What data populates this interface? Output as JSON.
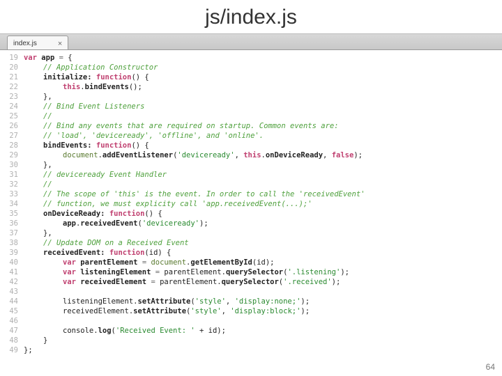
{
  "title": "js/index.js",
  "tab": {
    "label": "index.js",
    "close": "×"
  },
  "line_start": 19,
  "line_end": 49,
  "page_number": "64",
  "code_lines": [
    [
      [
        "kw",
        "var"
      ],
      [
        "pl",
        " "
      ],
      [
        "nm",
        "app"
      ],
      [
        "pl",
        " "
      ],
      [
        "op",
        "="
      ],
      [
        "pl",
        " {"
      ]
    ],
    [
      [
        "ind1",
        ""
      ],
      [
        "cm",
        "// Application Constructor"
      ]
    ],
    [
      [
        "ind1",
        ""
      ],
      [
        "nm",
        "initialize:"
      ],
      [
        "pl",
        " "
      ],
      [
        "kw",
        "function"
      ],
      [
        "pl",
        "() {"
      ]
    ],
    [
      [
        "ind2",
        ""
      ],
      [
        "kw",
        "this"
      ],
      [
        "pl",
        "."
      ],
      [
        "nm",
        "bindEvents"
      ],
      [
        "pl",
        "();"
      ]
    ],
    [
      [
        "ind1",
        ""
      ],
      [
        "pl",
        "},"
      ]
    ],
    [
      [
        "ind1",
        ""
      ],
      [
        "cm",
        "// Bind Event Listeners"
      ]
    ],
    [
      [
        "ind1",
        ""
      ],
      [
        "cm",
        "//"
      ]
    ],
    [
      [
        "ind1",
        ""
      ],
      [
        "cm",
        "// Bind any events that are required on startup. Common events are:"
      ]
    ],
    [
      [
        "ind1",
        ""
      ],
      [
        "cm",
        "// 'load', 'deviceready', 'offline', and 'online'."
      ]
    ],
    [
      [
        "ind1",
        ""
      ],
      [
        "nm",
        "bindEvents:"
      ],
      [
        "pl",
        " "
      ],
      [
        "kw",
        "function"
      ],
      [
        "pl",
        "() {"
      ]
    ],
    [
      [
        "ind2",
        ""
      ],
      [
        "doc",
        "document"
      ],
      [
        "pl",
        "."
      ],
      [
        "nm",
        "addEventListener"
      ],
      [
        "pl",
        "("
      ],
      [
        "str",
        "'deviceready'"
      ],
      [
        "pl",
        ", "
      ],
      [
        "kw",
        "this"
      ],
      [
        "pl",
        "."
      ],
      [
        "nm",
        "onDeviceReady"
      ],
      [
        "pl",
        ", "
      ],
      [
        "kw",
        "false"
      ],
      [
        "pl",
        ");"
      ]
    ],
    [
      [
        "ind1",
        ""
      ],
      [
        "pl",
        "},"
      ]
    ],
    [
      [
        "ind1",
        ""
      ],
      [
        "cm",
        "// deviceready Event Handler"
      ]
    ],
    [
      [
        "ind1",
        ""
      ],
      [
        "cm",
        "//"
      ]
    ],
    [
      [
        "ind1",
        ""
      ],
      [
        "cm",
        "// The scope of 'this' is the event. In order to call the 'receivedEvent'"
      ]
    ],
    [
      [
        "ind1",
        ""
      ],
      [
        "cm",
        "// function, we must explicity call 'app.receivedEvent(...);'"
      ]
    ],
    [
      [
        "ind1",
        ""
      ],
      [
        "nm",
        "onDeviceReady:"
      ],
      [
        "pl",
        " "
      ],
      [
        "kw",
        "function"
      ],
      [
        "pl",
        "() {"
      ]
    ],
    [
      [
        "ind2",
        ""
      ],
      [
        "nm",
        "app"
      ],
      [
        "pl",
        "."
      ],
      [
        "nm",
        "receivedEvent"
      ],
      [
        "pl",
        "("
      ],
      [
        "str",
        "'deviceready'"
      ],
      [
        "pl",
        ");"
      ]
    ],
    [
      [
        "ind1",
        ""
      ],
      [
        "pl",
        "},"
      ]
    ],
    [
      [
        "ind1",
        ""
      ],
      [
        "cm",
        "// Update DOM on a Received Event"
      ]
    ],
    [
      [
        "ind1",
        ""
      ],
      [
        "nm",
        "receivedEvent:"
      ],
      [
        "pl",
        " "
      ],
      [
        "kw",
        "function"
      ],
      [
        "pl",
        "("
      ],
      [
        "pl",
        "id"
      ],
      [
        "pl",
        ") {"
      ]
    ],
    [
      [
        "ind2",
        ""
      ],
      [
        "kw",
        "var"
      ],
      [
        "pl",
        " "
      ],
      [
        "nm",
        "parentElement"
      ],
      [
        "pl",
        " "
      ],
      [
        "op",
        "="
      ],
      [
        "pl",
        " "
      ],
      [
        "doc",
        "document"
      ],
      [
        "pl",
        "."
      ],
      [
        "nm",
        "getElementById"
      ],
      [
        "pl",
        "(id);"
      ]
    ],
    [
      [
        "ind2",
        ""
      ],
      [
        "kw",
        "var"
      ],
      [
        "pl",
        " "
      ],
      [
        "nm",
        "listeningElement"
      ],
      [
        "pl",
        " "
      ],
      [
        "op",
        "="
      ],
      [
        "pl",
        " parentElement."
      ],
      [
        "nm",
        "querySelector"
      ],
      [
        "pl",
        "("
      ],
      [
        "str",
        "'.listening'"
      ],
      [
        "pl",
        ");"
      ]
    ],
    [
      [
        "ind2",
        ""
      ],
      [
        "kw",
        "var"
      ],
      [
        "pl",
        " "
      ],
      [
        "nm",
        "receivedElement"
      ],
      [
        "pl",
        " "
      ],
      [
        "op",
        "="
      ],
      [
        "pl",
        " parentElement."
      ],
      [
        "nm",
        "querySelector"
      ],
      [
        "pl",
        "("
      ],
      [
        "str",
        "'.received'"
      ],
      [
        "pl",
        ");"
      ]
    ],
    [],
    [
      [
        "ind2",
        ""
      ],
      [
        "pl",
        "listeningElement."
      ],
      [
        "nm",
        "setAttribute"
      ],
      [
        "pl",
        "("
      ],
      [
        "str",
        "'style'"
      ],
      [
        "pl",
        ", "
      ],
      [
        "str",
        "'display:none;'"
      ],
      [
        "pl",
        ");"
      ]
    ],
    [
      [
        "ind2",
        ""
      ],
      [
        "pl",
        "receivedElement."
      ],
      [
        "nm",
        "setAttribute"
      ],
      [
        "pl",
        "("
      ],
      [
        "str",
        "'style'"
      ],
      [
        "pl",
        ", "
      ],
      [
        "str",
        "'display:block;'"
      ],
      [
        "pl",
        ");"
      ]
    ],
    [],
    [
      [
        "ind2",
        ""
      ],
      [
        "pl",
        "console."
      ],
      [
        "nm",
        "log"
      ],
      [
        "pl",
        "("
      ],
      [
        "str",
        "'Received Event: '"
      ],
      [
        "pl",
        " + id);"
      ]
    ],
    [
      [
        "ind1",
        ""
      ],
      [
        "pl",
        "}"
      ]
    ],
    [
      [
        "pl",
        "};"
      ]
    ]
  ]
}
